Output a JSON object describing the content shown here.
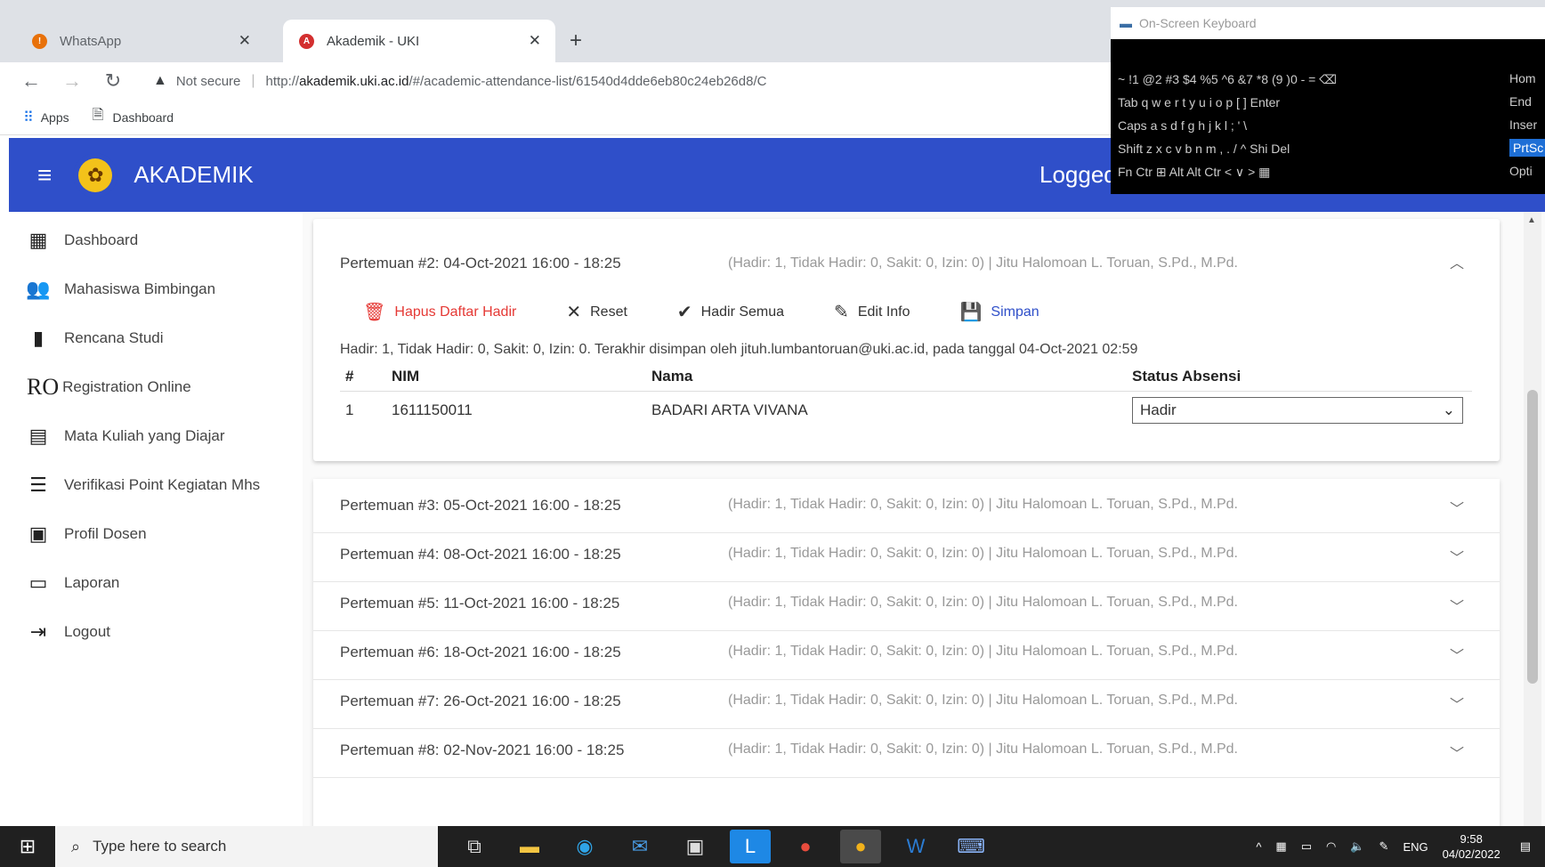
{
  "browser": {
    "tabs": [
      {
        "label": "WhatsApp",
        "active": false
      },
      {
        "label": "Akademik - UKI",
        "active": true
      }
    ],
    "new_tab": "+",
    "security": "Not secure",
    "url_prefix": "http://",
    "url_host": "akademik.uki.ac.id",
    "url_path": "/#/academic-attendance-list/61540d4dde6eb80c24eb26d8/C",
    "bookmarks": [
      {
        "label": "Apps",
        "icon": "apps-grid-icon"
      },
      {
        "label": "Dashboard",
        "icon": "bookmark-page-icon"
      }
    ]
  },
  "app": {
    "title": "AKADEMIK",
    "logged": "Logged"
  },
  "sidebar": {
    "items": [
      {
        "label": "Dashboard",
        "icon": "dashboard-icon"
      },
      {
        "label": "Mahasiswa Bimbingan",
        "icon": "people-icon"
      },
      {
        "label": "Rencana Studi",
        "icon": "book-icon"
      },
      {
        "label": "Registration Online",
        "icon": "ro-icon",
        "prefix": "RO"
      },
      {
        "label": "Mata Kuliah yang Diajar",
        "icon": "library-icon"
      },
      {
        "label": "Verifikasi Point Kegiatan Mhs",
        "icon": "checklist-icon"
      },
      {
        "label": "Profil Dosen",
        "icon": "profile-card-icon"
      },
      {
        "label": "Laporan",
        "icon": "folder-icon"
      },
      {
        "label": "Logout",
        "icon": "logout-icon"
      }
    ]
  },
  "meetings": {
    "open": {
      "title": "Pertemuan #2: 04-Oct-2021 16:00 - 18:25",
      "info": "(Hadir: 1, Tidak Hadir: 0, Sakit: 0, Izin: 0) | Jitu Halomoan L. Toruan, S.Pd., M.Pd.",
      "actions": [
        {
          "label": "Hapus Daftar Hadir",
          "icon": "trash-icon"
        },
        {
          "label": "Reset",
          "icon": "close-x-icon"
        },
        {
          "label": "Hadir Semua",
          "icon": "check-circle-icon"
        },
        {
          "label": "Edit Info",
          "icon": "pencil-icon"
        },
        {
          "label": "Simpan",
          "icon": "save-icon"
        }
      ],
      "summary": "Hadir: 1, Tidak Hadir: 0, Sakit: 0, Izin: 0. Terakhir disimpan oleh jituh.lumbantoruan@uki.ac.id, pada tanggal 04-Oct-2021 02:59",
      "columns": [
        "#",
        "NIM",
        "Nama",
        "Status Absensi"
      ],
      "rows": [
        {
          "no": "1",
          "nim": "1611150011",
          "nama": "BADARI ARTA VIVANA",
          "status": "Hadir"
        }
      ]
    },
    "collapsed": [
      {
        "title": "Pertemuan #3: 05-Oct-2021 16:00 - 18:25",
        "info": "(Hadir: 1, Tidak Hadir: 0, Sakit: 0, Izin: 0) | Jitu Halomoan L. Toruan, S.Pd., M.Pd."
      },
      {
        "title": "Pertemuan #4: 08-Oct-2021 16:00 - 18:25",
        "info": "(Hadir: 1, Tidak Hadir: 0, Sakit: 0, Izin: 0) | Jitu Halomoan L. Toruan, S.Pd., M.Pd."
      },
      {
        "title": "Pertemuan #5: 11-Oct-2021 16:00 - 18:25",
        "info": "(Hadir: 1, Tidak Hadir: 0, Sakit: 0, Izin: 0) | Jitu Halomoan L. Toruan, S.Pd., M.Pd."
      },
      {
        "title": "Pertemuan #6: 18-Oct-2021 16:00 - 18:25",
        "info": "(Hadir: 1, Tidak Hadir: 0, Sakit: 0, Izin: 0) | Jitu Halomoan L. Toruan, S.Pd., M.Pd."
      },
      {
        "title": "Pertemuan #7: 26-Oct-2021 16:00 - 18:25",
        "info": "(Hadir: 1, Tidak Hadir: 0, Sakit: 0, Izin: 0) | Jitu Halomoan L. Toruan, S.Pd., M.Pd."
      },
      {
        "title": "Pertemuan #8: 02-Nov-2021 16:00 - 18:25",
        "info": "(Hadir: 1, Tidak Hadir: 0, Sakit: 0, Izin: 0) | Jitu Halomoan L. Toruan, S.Pd., M.Pd."
      }
    ]
  },
  "osk": {
    "title": "On-Screen Keyboard",
    "rows": [
      "~  !1  @2  #3  $4  %5  ^6  &7  *8  (9  )0  -  =  ⌫",
      "Tab  q  w  e  r  t  y  u  i  o  p  [  ]  Enter",
      "Caps  a  s  d  f  g  h  j  k  l  ;  '  \\",
      "Shift  z  x  c  v  b  n  m  ,  .  /  ^  Shi  Del",
      "Fn  Ctr  ⊞  Alt                       Alt  Ctr  <  ∨  >  ▦"
    ],
    "side_keys": [
      "Hom",
      "End",
      "Inser",
      "PrtSc",
      "Opti"
    ]
  },
  "taskbar": {
    "search_placeholder": "Type here to search",
    "language": "ENG",
    "time": "9:58",
    "date": "04/02/2022"
  },
  "colors": {
    "header_blue": "#2f4fc9",
    "delete_red": "#e53935",
    "save_blue": "#2f4fc9"
  }
}
